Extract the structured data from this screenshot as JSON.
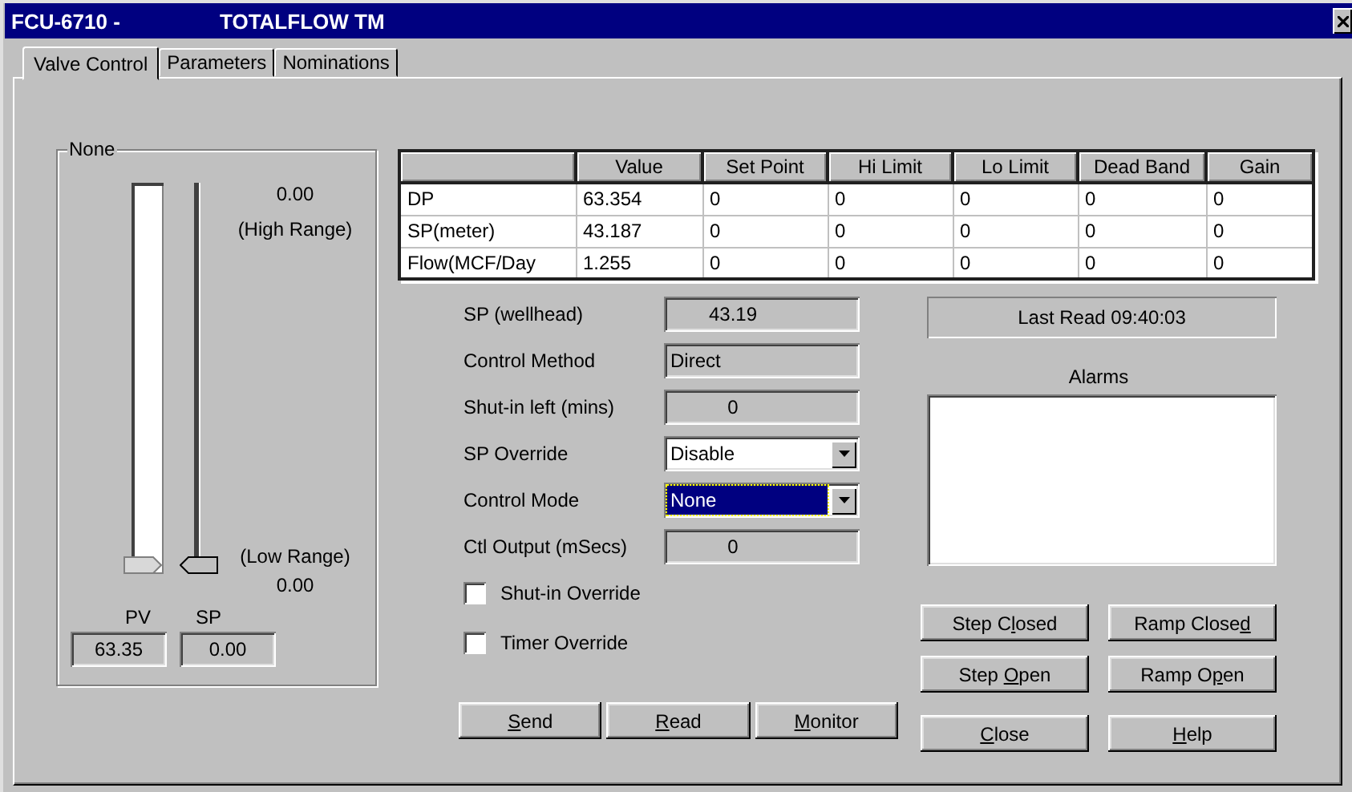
{
  "window": {
    "title": "FCU-6710 -",
    "subtitle": "TOTALFLOW TM"
  },
  "tabs": [
    {
      "label": "Valve Control",
      "selected": true
    },
    {
      "label": "Parameters",
      "selected": false
    },
    {
      "label": "Nominations",
      "selected": false
    }
  ],
  "gauge": {
    "title": "None",
    "high_value": "0.00",
    "high_label": "(High Range)",
    "low_label": "(Low Range)",
    "low_value": "0.00",
    "pv": {
      "label": "PV",
      "value": "63.35",
      "level": 0
    },
    "sp": {
      "label": "SP",
      "value": "0.00",
      "level": 0
    }
  },
  "table": {
    "columns": [
      "Value",
      "Set Point",
      "Hi Limit",
      "Lo Limit",
      "Dead Band",
      "Gain"
    ],
    "rows": [
      {
        "name": "DP",
        "cells": [
          "63.354",
          "0",
          "0",
          "0",
          "0",
          "0"
        ]
      },
      {
        "name": "SP(meter)",
        "cells": [
          "43.187",
          "0",
          "0",
          "0",
          "0",
          "0"
        ]
      },
      {
        "name": "Flow(MCF/Day",
        "cells": [
          "1.255",
          "0",
          "0",
          "0",
          "0",
          "0"
        ]
      }
    ]
  },
  "form": [
    {
      "kind": "number",
      "label": "SP (wellhead)",
      "value": "43.19"
    },
    {
      "kind": "text",
      "label": "Control Method",
      "value": "Direct"
    },
    {
      "kind": "number",
      "label": "Shut-in left (mins)",
      "value": "0"
    },
    {
      "kind": "dropdown",
      "label": "SP Override",
      "value": "Disable",
      "focused": false
    },
    {
      "kind": "dropdown",
      "label": "Control Mode",
      "value": "None",
      "focused": true
    },
    {
      "kind": "number",
      "label": "Ctl Output (mSecs)",
      "value": "0"
    }
  ],
  "checkboxes": [
    {
      "label": "Shut-in Override",
      "checked": false
    },
    {
      "label": "Timer Override",
      "checked": false
    }
  ],
  "last_read": "Last Read 09:40:03",
  "alarms": {
    "label": "Alarms"
  },
  "valve_buttons": [
    {
      "before": "Step C",
      "key": "l",
      "after": "osed"
    },
    {
      "before": "Ramp Close",
      "key": "d"
    },
    {
      "before": "Step ",
      "key": "O",
      "after": "pen"
    },
    {
      "before": "Ramp O",
      "key": "p",
      "after": "en"
    }
  ],
  "buttons": [
    {
      "key": "S",
      "after": "end"
    },
    {
      "key": "R",
      "after": "ead"
    },
    {
      "key": "M",
      "after": "onitor"
    },
    {
      "key": "C",
      "after": "lose"
    },
    {
      "key": "H",
      "after": "elp"
    }
  ]
}
